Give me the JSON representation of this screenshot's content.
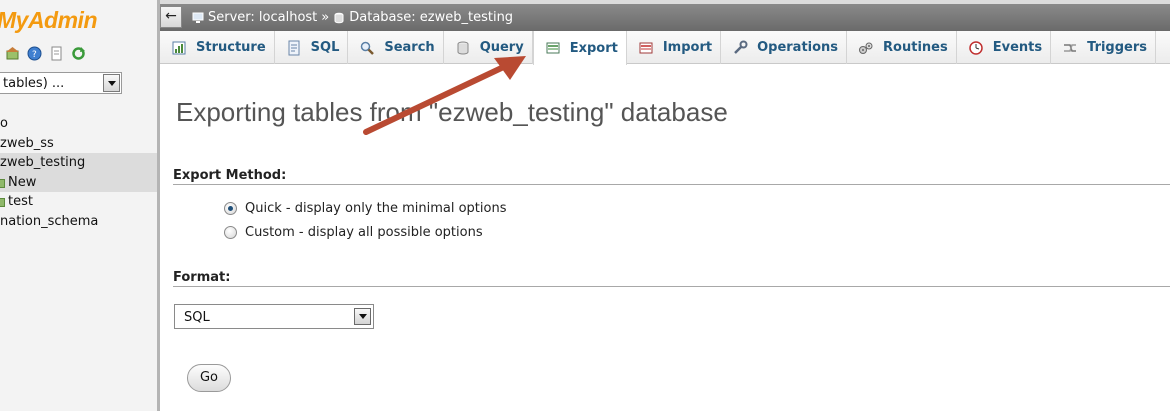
{
  "left_panel": {
    "logo_text": "MyAdmin",
    "db_select_value": "tables) ...",
    "tree": [
      {
        "label": "o",
        "highlight": false
      },
      {
        "label": "zweb_ss",
        "highlight": false
      },
      {
        "label": "zweb_testing",
        "highlight": true
      },
      {
        "label": "New",
        "highlight": true
      },
      {
        "label": "test",
        "highlight": false
      },
      {
        "label": "nation_schema",
        "highlight": false
      }
    ]
  },
  "top_bar": {
    "back_icon": "←",
    "server_label": "Server: localhost",
    "separator": "»",
    "database_label": "Database: ezweb_testing"
  },
  "tabs": [
    {
      "label": "Structure",
      "icon": "structure-icon"
    },
    {
      "label": "SQL",
      "icon": "sql-icon"
    },
    {
      "label": "Search",
      "icon": "search-icon"
    },
    {
      "label": "Query",
      "icon": "query-icon"
    },
    {
      "label": "Export",
      "icon": "export-icon",
      "active": true
    },
    {
      "label": "Import",
      "icon": "import-icon"
    },
    {
      "label": "Operations",
      "icon": "wrench-icon"
    },
    {
      "label": "Routines",
      "icon": "routines-icon"
    },
    {
      "label": "Events",
      "icon": "clock-icon"
    },
    {
      "label": "Triggers",
      "icon": "triggers-icon"
    }
  ],
  "main": {
    "title": "Exporting tables from \"ezweb_testing\" database",
    "export_method": {
      "heading": "Export Method:",
      "options": [
        {
          "label": "Quick - display only the minimal options",
          "checked": true
        },
        {
          "label": "Custom - display all possible options",
          "checked": false
        }
      ]
    },
    "format": {
      "heading": "Format:",
      "selected": "SQL"
    },
    "go_label": "Go"
  },
  "colors": {
    "accent": "#235a81",
    "logo": "#f39a10",
    "arrow": "#b94a32"
  }
}
